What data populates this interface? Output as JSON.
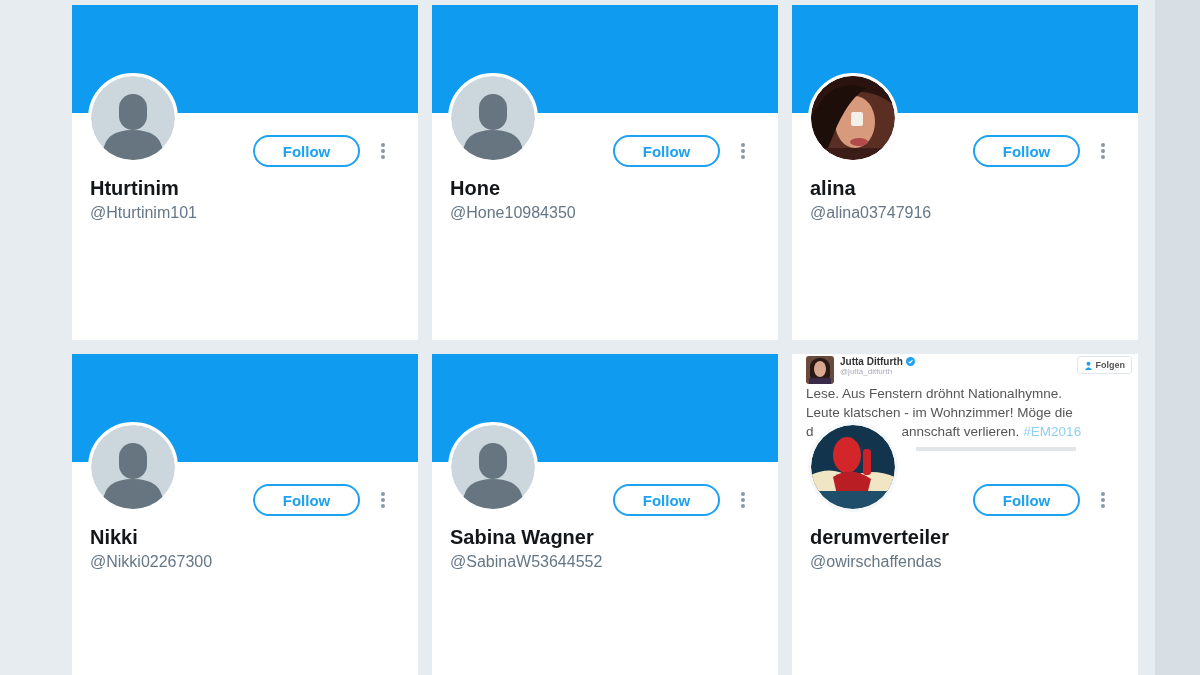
{
  "cards": [
    {
      "name": "Hturtinim",
      "handle": "@Hturtinim101",
      "avatar": {
        "kind": "default"
      },
      "header": {
        "kind": "banner"
      },
      "follow": "Follow"
    },
    {
      "name": "Hone",
      "handle": "@Hone10984350",
      "avatar": {
        "kind": "default"
      },
      "header": {
        "kind": "banner"
      },
      "follow": "Follow"
    },
    {
      "name": "alina",
      "handle": "@alina03747916",
      "header": {
        "kind": "banner"
      },
      "follow": "Follow"
    },
    {
      "name": "Nikki",
      "handle": "@Nikki02267300",
      "avatar": {
        "kind": "default"
      },
      "header": {
        "kind": "banner"
      },
      "follow": "Follow"
    },
    {
      "name": "Sabina Wagner",
      "handle": "@SabinaW53644552",
      "avatar": {
        "kind": "default"
      },
      "header": {
        "kind": "banner"
      },
      "follow": "Follow"
    },
    {
      "name": "derumverteiler",
      "handle": "@owirschaffendas",
      "header": {
        "kind": "tweet",
        "author": "Jutta Ditfurth",
        "author_handle": "@jutta_ditfurth",
        "follow": "Folgen",
        "line_1": "Lese. Aus Fenstern dröhnt Nationalhymne.",
        "line_2": "Leute klatschen - im Wohnzimmer! Möge die",
        "line_3_start": "d",
        "line_3_end": "annschaft verlieren.",
        "hashtag": "#EM2016"
      },
      "follow": "Follow"
    }
  ]
}
